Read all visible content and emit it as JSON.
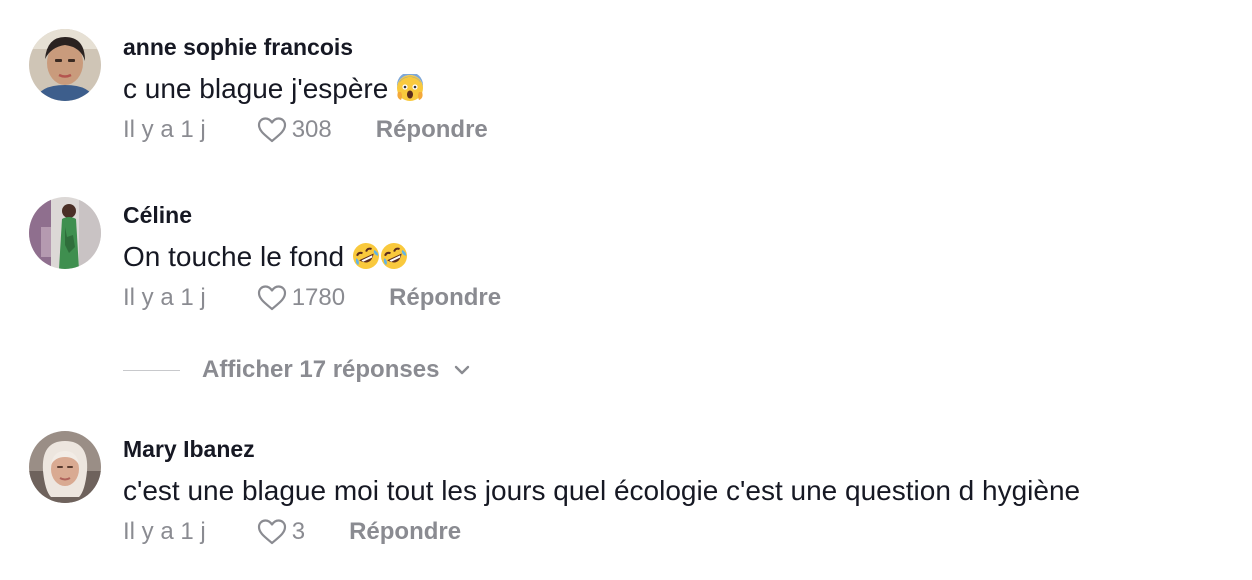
{
  "comments": [
    {
      "username": "anne sophie francois",
      "text": "c une blague j'espère",
      "emoji": [
        "scream-emoji"
      ],
      "time": "Il y a 1 j",
      "likes": "308",
      "reply_label": "Répondre"
    },
    {
      "username": "Céline",
      "text": "On touche le fond",
      "emoji": [
        "rofl-emoji",
        "rofl-emoji"
      ],
      "time": "Il y a 1 j",
      "likes": "1780",
      "reply_label": "Répondre"
    },
    {
      "username": "Mary Ibanez",
      "text": "c'est une blague moi tout les jours quel écologie c'est une question d hygiène",
      "emoji": [],
      "time": "Il y a 1 j",
      "likes": "3",
      "reply_label": "Répondre"
    }
  ],
  "show_replies": {
    "label": "Afficher 17 réponses",
    "icon": "chevron-down-icon"
  },
  "colors": {
    "primary_text": "#161823",
    "secondary_text": "#8a8b91",
    "divider": "#c8c9cc",
    "background": "#ffffff"
  }
}
